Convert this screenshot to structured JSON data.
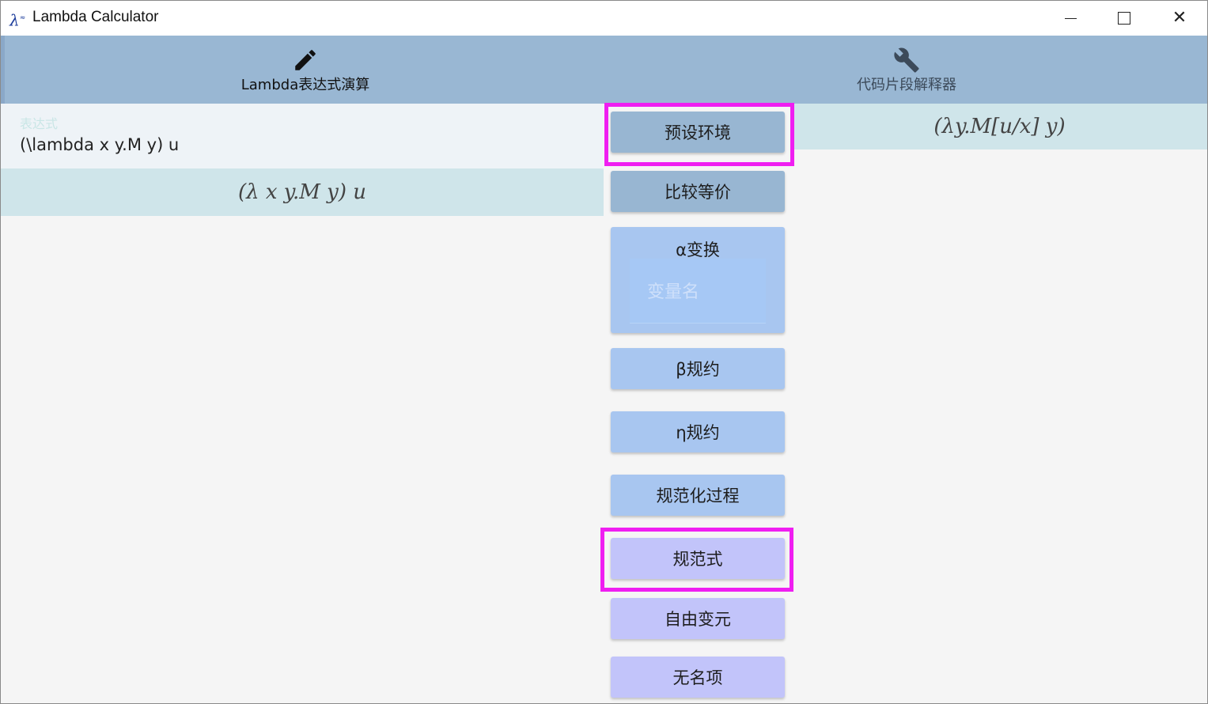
{
  "window": {
    "title": "Lambda Calculator",
    "icon": "lambda-app-icon"
  },
  "tabs": [
    {
      "label": "Lambda表达式演算",
      "icon": "pencil-icon",
      "active": true
    },
    {
      "label": "代码片段解释器",
      "icon": "wrench-icon",
      "active": false
    }
  ],
  "input": {
    "label": "表达式",
    "value": "(\\lambda x y.M y) u"
  },
  "left_render": "(λ x y.M y) u",
  "right_render": "(λy.M[u/x] y)",
  "buttons": {
    "preset_env": "预设环境",
    "compare_equiv": "比较等价",
    "alpha_title": "α变换",
    "alpha_placeholder": "变量名",
    "beta": "β规约",
    "eta": "η规约",
    "normalize_process": "规范化过程",
    "normal_form": "规范式",
    "free_vars": "自由变元",
    "nameless": "无名项"
  },
  "colors": {
    "tabbar": "#99b7d3",
    "render_bg": "#cfe5ea",
    "highlight": "#ef1ef1",
    "button_dark": "#98b6d2",
    "button_light": "#a8c6f0",
    "button_violet": "#c2c4fa"
  }
}
